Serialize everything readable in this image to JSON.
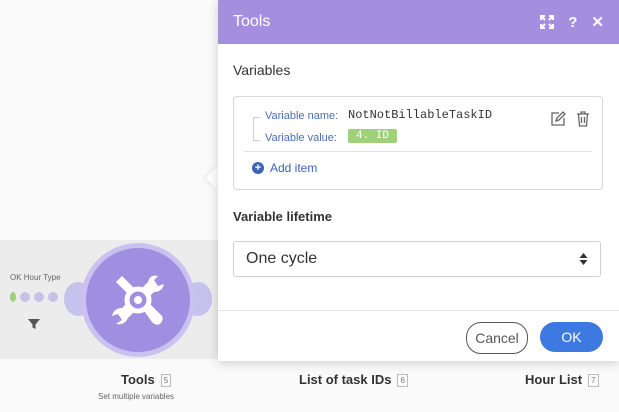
{
  "canvas": {
    "filter_label": "OK Hour Type",
    "modules": [
      {
        "label": "Tools",
        "number": "5",
        "subtitle": "Set multiple variables"
      },
      {
        "label": "List of task IDs",
        "number": "6"
      },
      {
        "label": "Hour List",
        "number": "7"
      }
    ],
    "colors": {
      "module_fill": "#9f8fe0",
      "module_ring": "#c9c2f1",
      "band": "#ececec"
    }
  },
  "panel": {
    "title": "Tools",
    "header_icons": [
      "expand-icon",
      "help-icon",
      "close-icon"
    ],
    "variables_label": "Variables",
    "variable": {
      "name_label": "Variable name:",
      "name_value": "NotNotBillableTaskID",
      "value_label": "Variable value:",
      "value_pill": "4. ID"
    },
    "add_item_label": "Add item",
    "lifetime_label": "Variable lifetime",
    "lifetime_value": "One cycle",
    "cancel_label": "Cancel",
    "ok_label": "OK",
    "colors": {
      "header": "#a38ee0",
      "ok_button": "#3d79e0",
      "pill": "#9fd07a",
      "link": "#3d63b8"
    }
  }
}
